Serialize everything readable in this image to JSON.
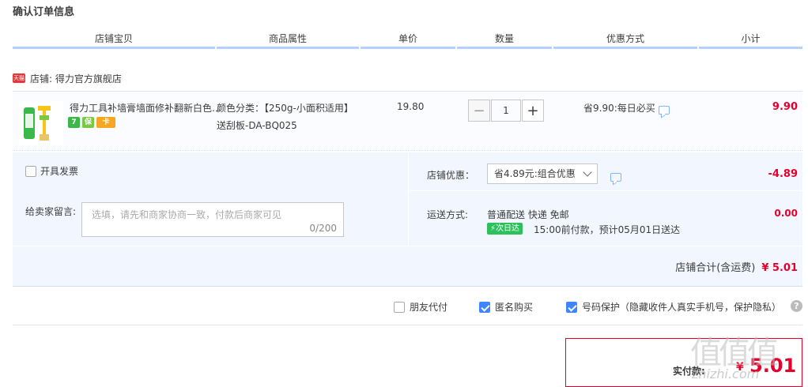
{
  "page_title": "确认订单信息",
  "columns": [
    "店铺宝贝",
    "商品属性",
    "单价",
    "数量",
    "优惠方式",
    "小计"
  ],
  "shop": {
    "badge": "天猫",
    "label": "店铺: 得力官方旗舰店"
  },
  "item": {
    "name": "得力工具补墙膏墙面修补翻新白色腻子膏",
    "badges": [
      "7",
      "保",
      "卡"
    ],
    "attr_color": "颜色分类：【250g-小面积适用】",
    "attr_gift": "送刮板-DA-BQ025",
    "price": "19.80",
    "quantity": "1",
    "minus": "−",
    "plus": "+",
    "promo": "省9.90:每日必买",
    "subtotal": "9.90"
  },
  "invoice_label": "开具发票",
  "shop_coupon": {
    "label": "店铺优惠：",
    "selected": "省4.89元:组合优惠",
    "amount": "-4.89"
  },
  "memo": {
    "label": "给卖家留言:",
    "placeholder": "选填，请先和商家协商一致，付款后商家可见",
    "count": "0/200"
  },
  "shipping": {
    "label": "运送方式:",
    "method": "普通配送 快递 免邮",
    "badge": "次日达",
    "eta": "15:00前付款，预计05月01日送达",
    "fee": "0.00"
  },
  "shop_total": {
    "label": "店铺合计(含运费)",
    "amount": "¥ 5.01"
  },
  "options": {
    "friend_pay": "朋友代付",
    "anonymous": "匿名购买",
    "number_protect": "号码保护（隐藏收件人真实手机号，保护隐私）",
    "help": "?"
  },
  "payment": {
    "label": "实付款:",
    "currency": "¥",
    "amount": "5.01"
  },
  "watermark": {
    "glyphs": "值值值",
    "text": "zhizhi.com"
  }
}
